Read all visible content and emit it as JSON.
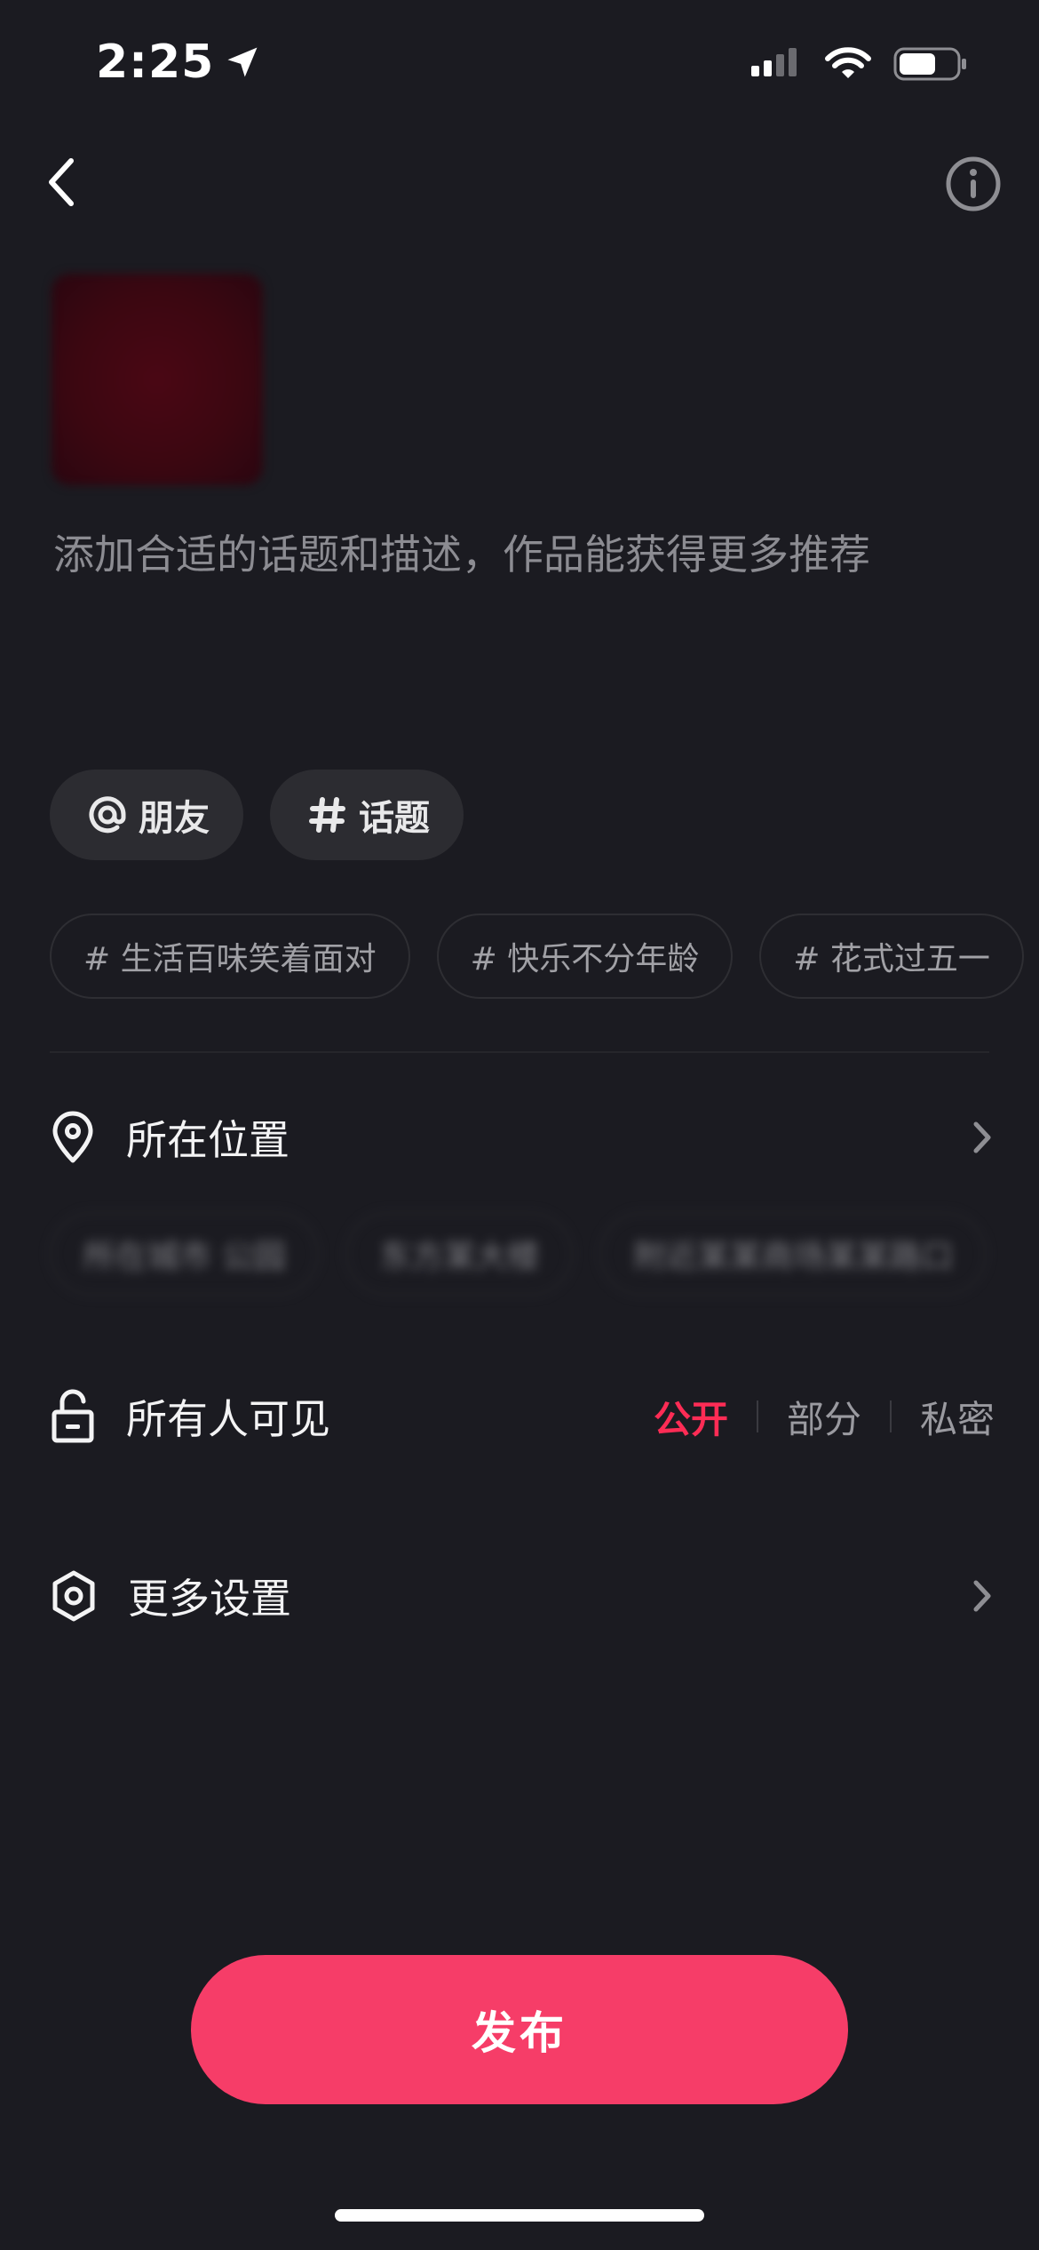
{
  "status_bar": {
    "time": "2:25"
  },
  "description_placeholder": "添加合适的话题和描述，作品能获得更多推荐",
  "action_chips": [
    {
      "label": "朋友",
      "icon": "at-icon"
    },
    {
      "label": "话题",
      "icon": "hashtag-icon"
    }
  ],
  "suggested_topics": [
    "# 生活百味笑着面对",
    "# 快乐不分年龄",
    "# 花式过五一"
  ],
  "location": {
    "label": "所在位置",
    "suggestions": [
      "所在城市 公园",
      "东方某大楼",
      "附近某某商场某某路口"
    ]
  },
  "visibility": {
    "label": "所有人可见",
    "options": [
      {
        "label": "公开",
        "active": true
      },
      {
        "label": "部分",
        "active": false
      },
      {
        "label": "私密",
        "active": false
      }
    ]
  },
  "more_settings": {
    "label": "更多设置"
  },
  "publish_button": {
    "label": "发布"
  },
  "colors": {
    "accent": "#fe2c55",
    "publish_bg": "#f63d68",
    "background": "#1b1b21"
  }
}
